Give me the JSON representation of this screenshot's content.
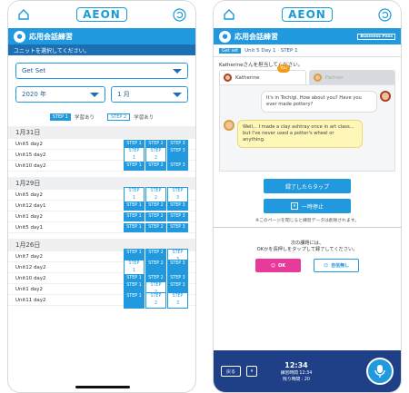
{
  "left": {
    "logo": "AEON",
    "title": "応用会話練習",
    "subtitle": "ユニットを選択してください。",
    "dropdown_level": "Get Set",
    "dropdown_year": "2020 年",
    "dropdown_month": "1 月",
    "legend": {
      "solid_label": "STEP 1",
      "solid_text": "学習あり",
      "outline_label": "STEP 2",
      "outline_text": "学習あり"
    },
    "groups": [
      {
        "date": "1月31日",
        "rows": [
          {
            "unit": "Unit5 day2",
            "steps": [
              1,
              1,
              1
            ]
          },
          {
            "unit": "Unit15 day2",
            "steps": [
              0,
              0,
              1
            ]
          },
          {
            "unit": "Unit10 day2",
            "steps": [
              1,
              1,
              1
            ]
          }
        ]
      },
      {
        "date": "1月29日",
        "rows": [
          {
            "unit": "Unit5 day2",
            "steps": [
              0,
              0,
              0
            ]
          },
          {
            "unit": "Unit12 day1",
            "steps": [
              1,
              1,
              1
            ]
          },
          {
            "unit": "Unit1 day2",
            "steps": [
              1,
              1,
              1
            ]
          },
          {
            "unit": "Unit5 day1",
            "steps": [
              1,
              1,
              1
            ]
          }
        ]
      },
      {
        "date": "1月26日",
        "rows": [
          {
            "unit": "Unit7 day2",
            "steps": [
              1,
              1,
              0
            ]
          },
          {
            "unit": "Unit12 day2",
            "steps": [
              0,
              1,
              1
            ]
          },
          {
            "unit": "Unit10 day2",
            "steps": [
              1,
              1,
              1
            ]
          },
          {
            "unit": "Unit1 day2",
            "steps": [
              1,
              0,
              1
            ]
          },
          {
            "unit": "Unit11 day2",
            "steps": [
              1,
              0,
              0
            ]
          }
        ]
      }
    ],
    "step_labels": [
      "STEP 1",
      "STEP 2",
      "STEP 3"
    ]
  },
  "right": {
    "logo": "AEON",
    "title": "応用会話練習",
    "badge": "Business Pass",
    "lesson_tag": "Get set",
    "lesson_text": "Unit 5 Day 1 · STEP 1",
    "instruction": "Katherineさんを担当してください。",
    "tab1": "Katherine",
    "tab2": "Partner",
    "you_badge": "You",
    "msg1": "It's in Tochigi. How about you? Have you ever made pottery?",
    "msg2": "Well... I made a clay ashtray once in art class... but I've never used a potter's wheel or anything.",
    "tap_button": "録了したらタップ",
    "stop_button": "一時停止",
    "note": "※このページを閉じると練習データは削除されます。",
    "finish_line1": "次の課題には、",
    "finish_line2": "OKかを長押しをタップして録了してください。",
    "ok_label": "OK",
    "ng_label": "自信無し",
    "back_label": "戻る",
    "clock_time": "12:34",
    "clock_sub1": "練習時間 12:34",
    "clock_sub2": "残り時間 : 20"
  }
}
